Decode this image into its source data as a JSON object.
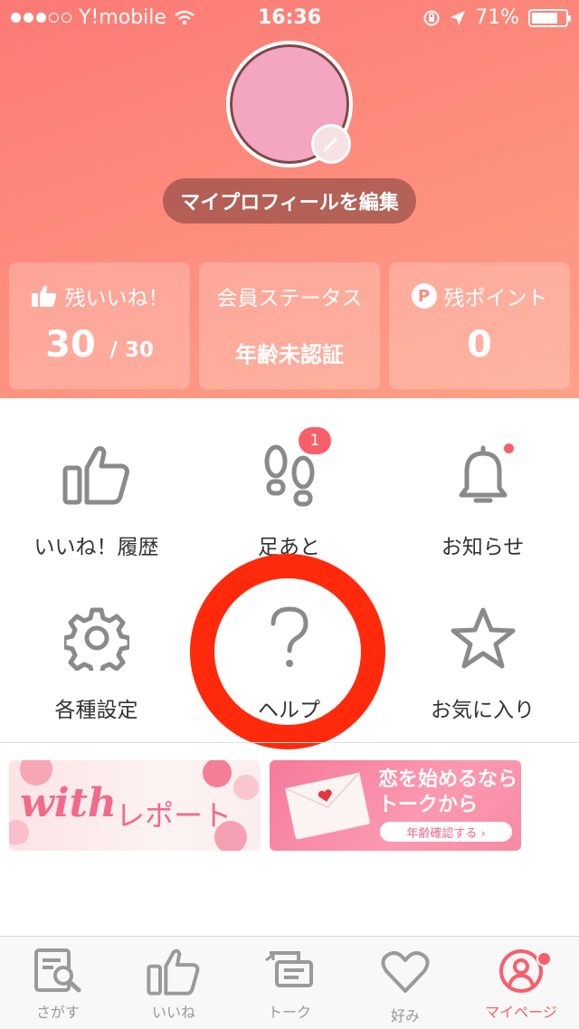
{
  "status_bar": {
    "carrier": "Y!mobile",
    "time": "16:36",
    "battery": "71%",
    "signal_filled": 3,
    "signal_total": 5
  },
  "profile": {
    "edit_label": "マイプロフィールを編集",
    "avatar_color": "#f4a5bf"
  },
  "stats": {
    "likes": {
      "label": "残いいね！",
      "value": "30",
      "max": "/ 30"
    },
    "member": {
      "label": "会員ステータス",
      "value": "年齢未認証"
    },
    "points": {
      "label": "残ポイント",
      "icon_text": "P",
      "value": "0"
    }
  },
  "menu": {
    "like_history": "いいね！履歴",
    "footprints": "足あと",
    "footprints_badge": "1",
    "notifications": "お知らせ",
    "settings": "各種設定",
    "help": "ヘルプ",
    "favorites": "お気に入り"
  },
  "banners": {
    "report": {
      "brand": "with",
      "text": "レポート"
    },
    "talk": {
      "line1": "恋を始めるなら",
      "line2": "トークから",
      "button": "年齢確認する ›"
    }
  },
  "tabbar": {
    "search": "さがす",
    "likes": "いいね",
    "talk": "トーク",
    "preferences": "好み",
    "mypage": "マイページ"
  },
  "colors": {
    "accent": "#f95f6b",
    "hero_gradient_start": "#fb7a76",
    "hero_gradient_end": "#fea087",
    "annotation_ring": "#ff2a0c",
    "icon_gray": "#8a8a8a"
  }
}
